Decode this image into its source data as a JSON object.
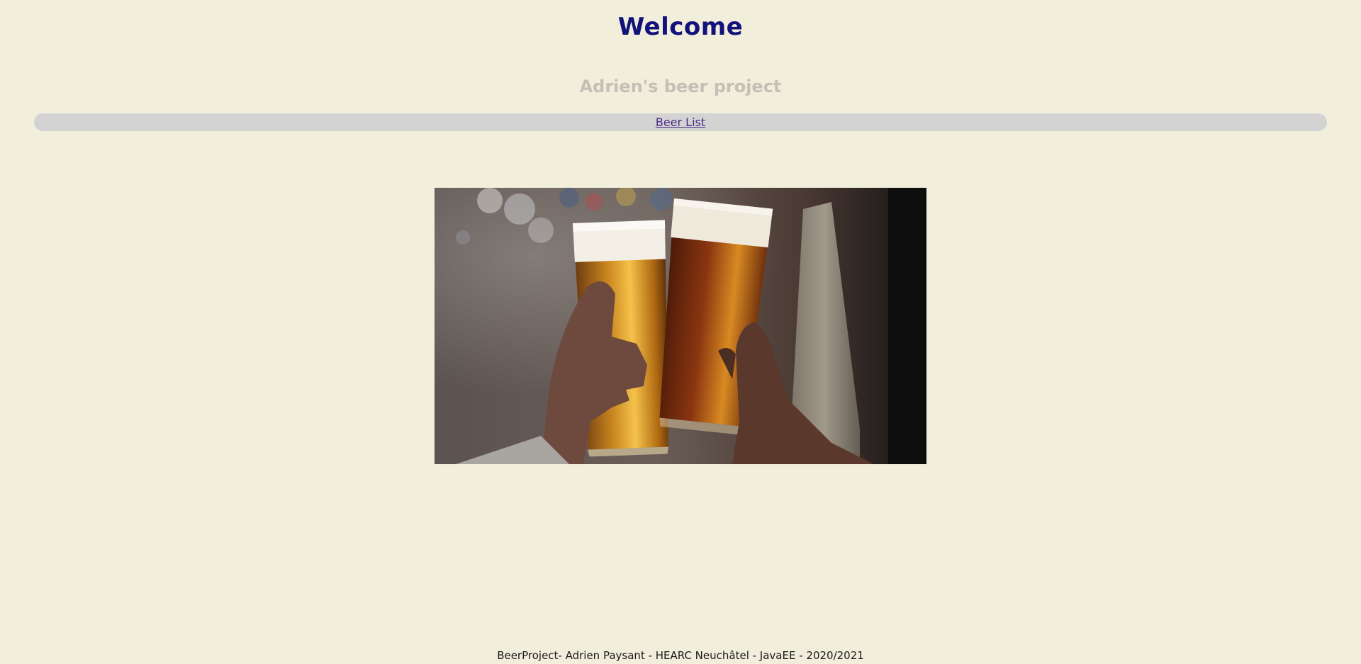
{
  "header": {
    "title": "Welcome",
    "subtitle": "Adrien's beer project"
  },
  "nav": {
    "items": [
      {
        "label": "Beer List"
      }
    ]
  },
  "footer": {
    "text": "BeerProject- Adrien Paysant - HEARC Neuchâtel - JavaEE - 2020/2021"
  },
  "colors": {
    "background": "#f2eedc",
    "title": "#12127a",
    "subtitle": "#c3c0b6",
    "nav_bar": "#d3d3d3",
    "link": "#4a2a86"
  }
}
